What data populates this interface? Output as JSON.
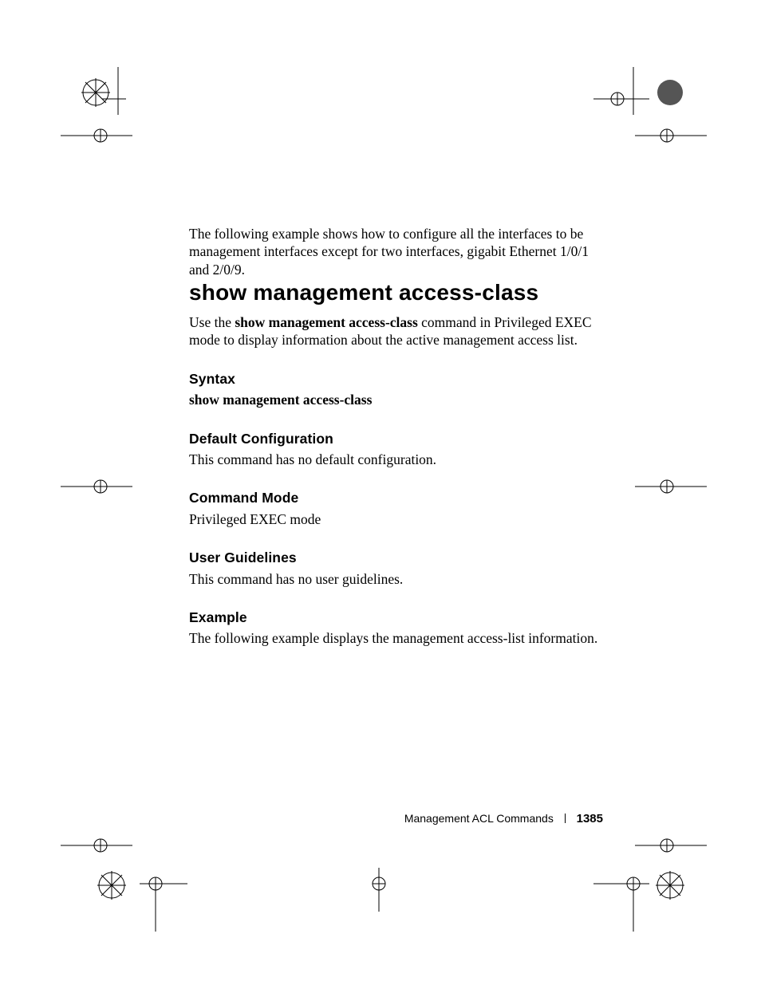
{
  "intro": "The following example shows how to configure all the interfaces to be management interfaces except for two interfaces, gigabit Ethernet 1/0/1 and 2/0/9.",
  "heading": "show management access-class",
  "desc_pre": "Use the ",
  "desc_cmd": "show management access-class",
  "desc_post": " command in Privileged EXEC mode to display information about the active management access list.",
  "sections": {
    "syntax": {
      "title": "Syntax",
      "body": "show management access-class",
      "bold": true
    },
    "default": {
      "title": "Default Configuration",
      "body": "This command has no default configuration."
    },
    "mode": {
      "title": "Command Mode",
      "body": "Privileged EXEC mode"
    },
    "guide": {
      "title": "User Guidelines",
      "body": "This command has no user guidelines."
    },
    "example": {
      "title": "Example",
      "body": "The following example displays the management access-list information."
    }
  },
  "footer": {
    "section": "Management ACL Commands",
    "page": "1385"
  }
}
